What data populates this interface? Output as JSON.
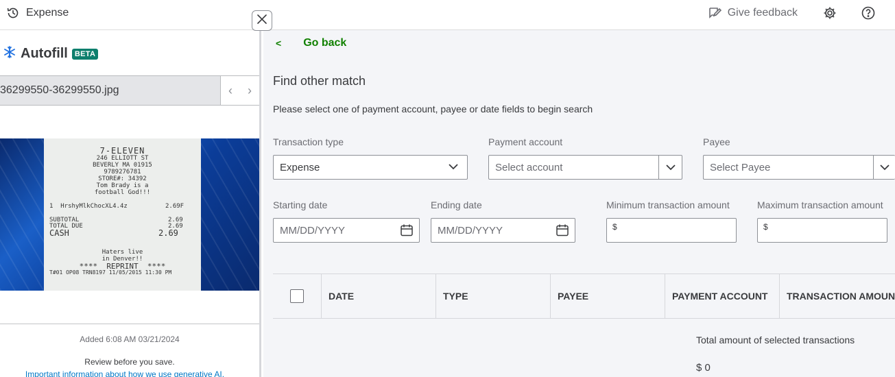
{
  "topbar": {
    "title": "Expense",
    "feedback_label": "Give feedback"
  },
  "autofill": {
    "title": "Autofill",
    "badge": "BETA",
    "filename": "36299550-36299550.jpg",
    "added_text": "Added 6:08 AM 03/21/2024",
    "review_text": "Review before you save.",
    "info_link": "Important information about how we use generative AI."
  },
  "receipt": {
    "store": "7-ELEVEN",
    "address1": "246 ELLIOTT ST",
    "address2": "BEVERLY MA 01915",
    "phone": "9789276781",
    "store_no": "STORE#: 34392",
    "msg1": "Tom Brady is a",
    "msg2": "football God!!!",
    "item": "1  HrshyMlkChocXL4.4z",
    "item_price": "2.69F",
    "subtotal_label": "SUBTOTAL",
    "subtotal": "2.69",
    "totaldue_label": "TOTAL DUE",
    "totaldue": "2.69",
    "cash_label": "CASH",
    "cash": "2.69",
    "footer1": "Haters live",
    "footer2": "in Denver!!",
    "reprint": "****  REPRINT  ****",
    "trans": "T#01 OP08 TRN8197 11/05/2015 11:30 PM"
  },
  "main": {
    "go_back": "Go back",
    "find_title": "Find other match",
    "instructions": "Please select one of payment account, payee or date fields to begin search",
    "transaction_type": {
      "label": "Transaction type",
      "value": "Expense"
    },
    "payment_account": {
      "label": "Payment account",
      "placeholder": "Select account"
    },
    "payee": {
      "label": "Payee",
      "placeholder": "Select Payee"
    },
    "starting_date": {
      "label": "Starting date",
      "placeholder": "MM/DD/YYYY"
    },
    "ending_date": {
      "label": "Ending date",
      "placeholder": "MM/DD/YYYY"
    },
    "min_amount": {
      "label": "Minimum transaction amount",
      "prefix": "$"
    },
    "max_amount": {
      "label": "Maximum transaction amount",
      "prefix": "$"
    },
    "table_headers": [
      "DATE",
      "TYPE",
      "PAYEE",
      "PAYMENT ACCOUNT",
      "TRANSACTION AMOUNT"
    ],
    "total_label": "Total amount of selected transactions",
    "total_value": "$ 0"
  },
  "colors": {
    "brand_green": "#108000",
    "beta_badge": "#0d7f6d",
    "link_blue": "#0077c5",
    "autofill_icon": "#1d6fe0"
  }
}
